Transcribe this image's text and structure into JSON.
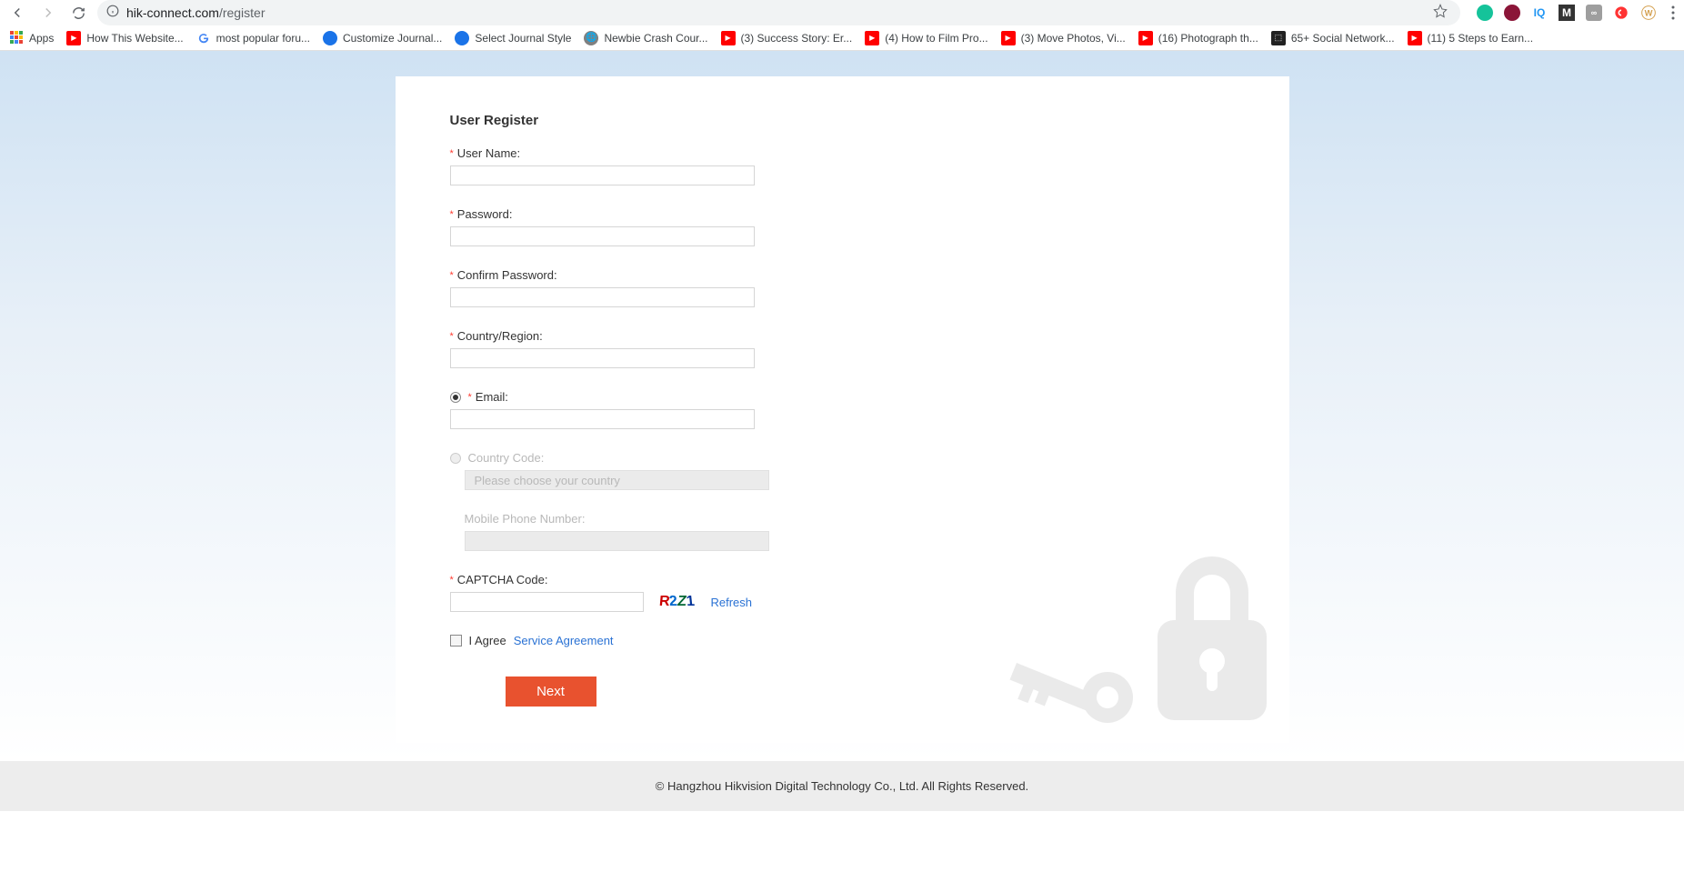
{
  "browser": {
    "url_host": "hik-connect.com",
    "url_path": "/register"
  },
  "bookmarks": {
    "apps": "Apps",
    "b1": "How This Website...",
    "b2": "most popular foru...",
    "b3": "Customize Journal...",
    "b4": "Select Journal Style",
    "b5": "Newbie Crash Cour...",
    "b6": "(3) Success Story: Er...",
    "b7": "(4) How to Film Pro...",
    "b8": "(3) Move Photos, Vi...",
    "b9": "(16) Photograph th...",
    "b10": "65+ Social Network...",
    "b11": "(11) 5 Steps to Earn..."
  },
  "form": {
    "title": "User Register",
    "username_label": "User Name:",
    "password_label": "Password:",
    "confirm_label": "Confirm Password:",
    "country_label": "Country/Region:",
    "email_label": "Email:",
    "ccode_label": "Country Code:",
    "ccode_placeholder": "Please choose your country",
    "mobile_label": "Mobile Phone Number:",
    "captcha_label": "CAPTCHA Code:",
    "refresh": "Refresh",
    "agree_text": "I Agree",
    "service_link": "Service Agreement",
    "next_btn": "Next"
  },
  "captcha": {
    "c1": "R",
    "c2": "2",
    "c3": "Z",
    "c4": "1"
  },
  "footer": {
    "text": "© Hangzhou Hikvision Digital Technology Co., Ltd. All Rights Reserved."
  }
}
